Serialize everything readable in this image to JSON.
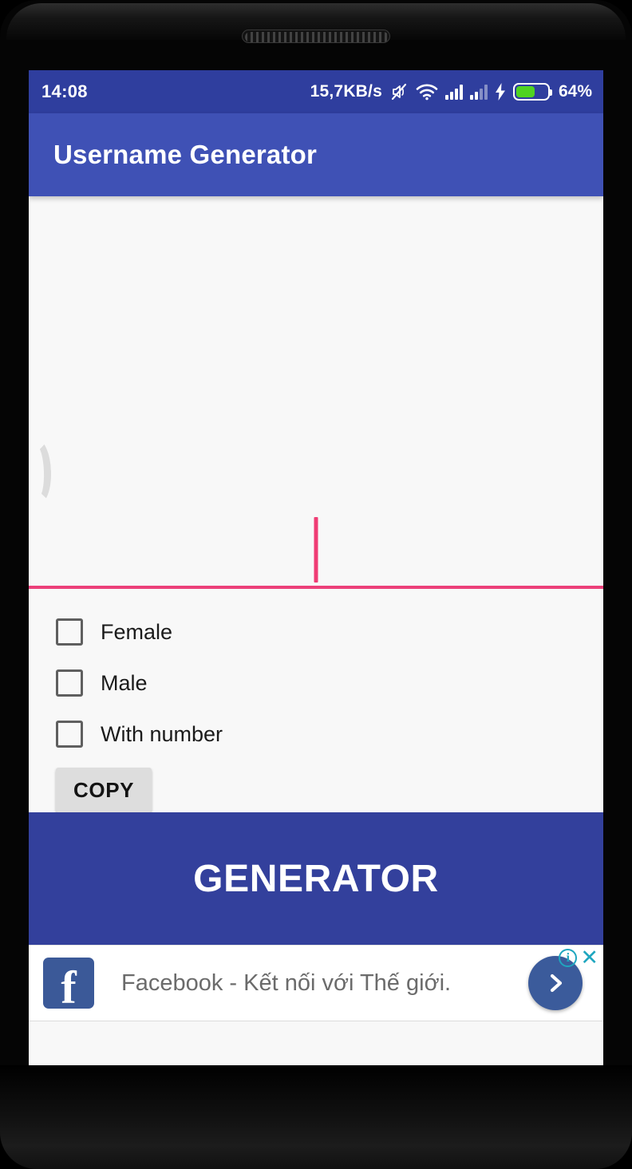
{
  "device": {
    "frame": "android-phone",
    "earpiece": "speaker-grille"
  },
  "status_bar": {
    "time": "14:08",
    "network_speed": "15,7KB/s",
    "icons": [
      "mute-icon",
      "wifi-icon",
      "signal-sim1-icon",
      "signal-sim2-icon",
      "charging-bolt-icon",
      "battery-icon"
    ],
    "battery_percent": "64%",
    "battery_level": 64,
    "background_color": "#2f3e9e"
  },
  "app_bar": {
    "title": "Username Generator",
    "background_color": "#3f51b5"
  },
  "main": {
    "username_input": {
      "value": "",
      "placeholder": "",
      "underline_color": "#ec407a",
      "caret_color": "#ef3d75"
    },
    "checkboxes": [
      {
        "label": "Female",
        "checked": false
      },
      {
        "label": "Male",
        "checked": false
      },
      {
        "label": "With number",
        "checked": false
      }
    ],
    "copy_button": {
      "label": "COPY",
      "background_color": "#dddddd"
    },
    "generator_button": {
      "label": "GENERATOR",
      "background_color": "#33409c"
    }
  },
  "ad": {
    "advertiser": "Facebook",
    "logo_glyph": "f",
    "text": "Facebook - Kết nối với Thế giới.",
    "cta": "chevron-right-icon",
    "info_glyph": "i",
    "close_glyph": "✕",
    "control_color": "#1fa6bf"
  }
}
